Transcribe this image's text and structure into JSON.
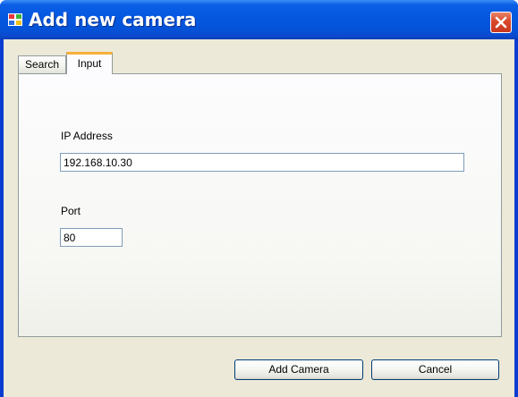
{
  "window": {
    "title": "Add new camera",
    "icon": "window-app-icon",
    "close_icon": "close-icon"
  },
  "tabs": [
    {
      "label": "Search",
      "selected": false
    },
    {
      "label": "Input",
      "selected": true
    }
  ],
  "form": {
    "ip_label": "IP Address",
    "ip_value": "192.168.10.30",
    "port_label": "Port",
    "port_value": "80"
  },
  "buttons": {
    "add_label": "Add Camera",
    "cancel_label": "Cancel"
  },
  "colors": {
    "titlebar": "#0558e0",
    "client_bg": "#ece9d8",
    "close_button": "#d9482a",
    "active_tab_accent": "#f6b03a",
    "field_border": "#7f9db9"
  }
}
